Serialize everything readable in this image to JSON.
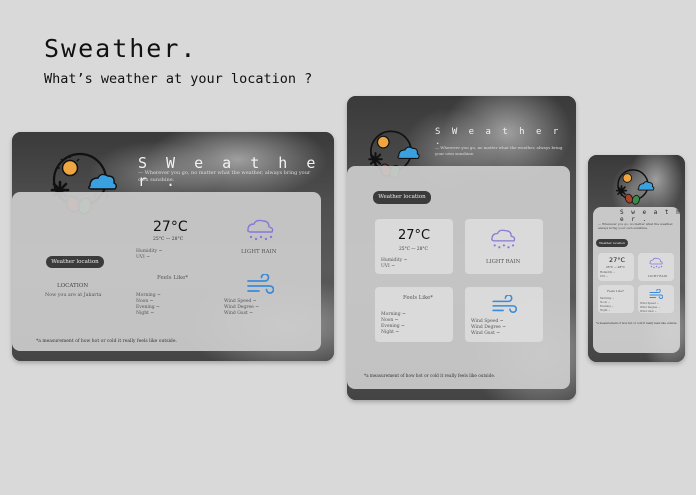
{
  "header": {
    "title": "Sweather.",
    "subtitle": "What’s weather at your location ?"
  },
  "app": {
    "brand": "S W e a t h e r .",
    "brand_mobile": "S w e a t h e r .",
    "tagline": "— Wherever you go, no matter what the weather, always bring your own sunshine.",
    "location_button": "Weather location",
    "location_heading": "LOCATION",
    "location_text": "Now you are at Jakarta",
    "temperature": "27°C",
    "temp_range": "25°C — 28°C",
    "humidity": "Humidity ~",
    "uvi": "UVI ~",
    "condition": "LIGHT RAIN",
    "feels_like": "Feels Like*",
    "morning": "Morning ~",
    "noon": "Noon ~",
    "evening": "Evening ~",
    "night": "Night ~",
    "wind_speed": "Wind Speed ~",
    "wind_degree": "Wind Degree ~",
    "wind_gust": "Wind Gust ~",
    "footnote": "*a measurement of how hot or cold it really feels like outside."
  },
  "colors": {
    "background": "#d9d9d9",
    "device_frame": "#3b3b3b",
    "panel": "#cdcdcd",
    "sun": "#f0a640",
    "cloud": "#3aa0e0",
    "rain": "#8a78d8",
    "wind": "#3a8ad8"
  },
  "icons": [
    "weather-logo-icon",
    "light-rain-icon",
    "wind-icon"
  ]
}
